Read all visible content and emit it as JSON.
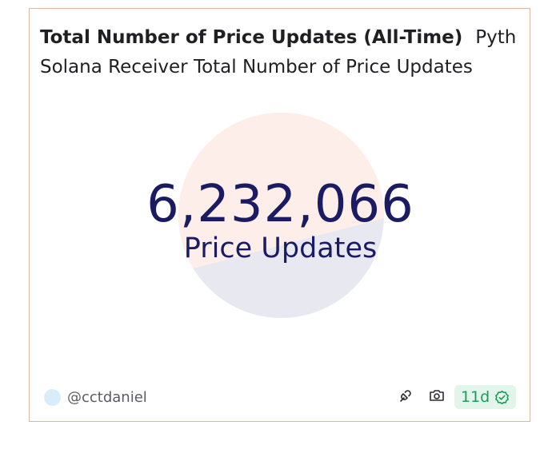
{
  "card": {
    "title": "Total Number of Price Updates (All-Time)",
    "source": "Pyth",
    "subtitle": "Solana Receiver Total Number of Price Updates"
  },
  "counter": {
    "value": "6,232,066",
    "label": "Price Updates"
  },
  "footer": {
    "author": "@cctdaniel",
    "age": "11d",
    "fork_icon": "fork-icon",
    "camera_icon": "camera-icon",
    "verified_icon": "verified-check-icon"
  },
  "colors": {
    "counter_text": "#1b1b63",
    "circle_top": "#fdeeea",
    "circle_bottom": "#e8e9f0",
    "badge_bg": "#e2f5ea",
    "badge_text": "#1f9a5a",
    "card_border": "#d9b8a6"
  }
}
